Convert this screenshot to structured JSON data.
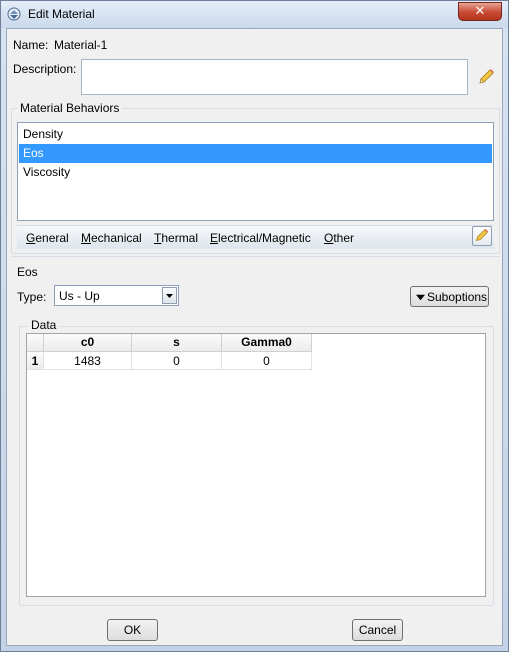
{
  "window": {
    "title": "Edit Material",
    "close_glyph": "✕"
  },
  "name": {
    "label": "Name:",
    "value": "Material-1"
  },
  "description": {
    "label": "Description:",
    "value": ""
  },
  "behaviors": {
    "title": "Material Behaviors",
    "items": [
      {
        "label": "Density",
        "selected": false
      },
      {
        "label": "Eos",
        "selected": true
      },
      {
        "label": "Viscosity",
        "selected": false
      }
    ]
  },
  "menus": {
    "general": {
      "accel": "G",
      "rest": "eneral"
    },
    "mechanical": {
      "accel": "M",
      "rest": "echanical"
    },
    "thermal": {
      "accel": "T",
      "rest": "hermal"
    },
    "electrical": {
      "accel": "E",
      "rest": "lectrical/Magnetic"
    },
    "other": {
      "accel": "O",
      "rest": "ther"
    }
  },
  "eos": {
    "section_title": "Eos",
    "type_label": "Type:",
    "type_value": "Us - Up",
    "suboptions_label": "Suboptions"
  },
  "data": {
    "title": "Data",
    "columns": [
      "c0",
      "s",
      "Gamma0"
    ],
    "rows": [
      {
        "index": "1",
        "values": [
          "1483",
          "0",
          "0"
        ]
      }
    ]
  },
  "buttons": {
    "ok": "OK",
    "cancel": "Cancel"
  },
  "icons": {
    "app": "edit-material-icon",
    "description_edit": "pencil-icon",
    "behavior_edit": "pencil-icon",
    "type_dropdown": "chevron-down-icon",
    "suboptions": "triangle-down-icon"
  }
}
